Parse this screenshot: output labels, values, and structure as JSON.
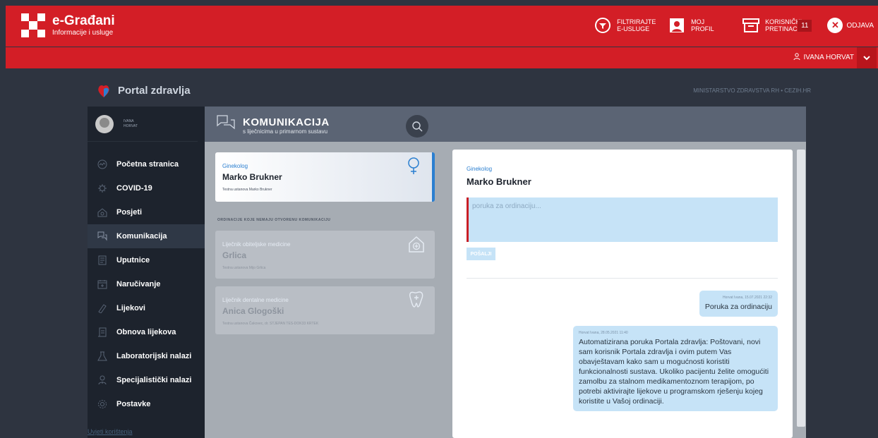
{
  "header": {
    "brand_title": "e-Građani",
    "brand_subtitle": "Informacije i usluge",
    "actions": [
      {
        "label": "FILTRIRAJTE E-USLUGE",
        "icon": "filter-icon"
      },
      {
        "label": "MOJ PROFIL",
        "icon": "profile-icon"
      },
      {
        "label": "KORISNIČKI PRETINAC",
        "icon": "inbox-icon",
        "badge": "11"
      }
    ],
    "logout_label": "ODJAVA"
  },
  "userbar": {
    "user_name": "IVANA HORVAT"
  },
  "portal": {
    "title": "Portal zdravlja",
    "ministry": "MINISTARSTVO ZDRAVSTVA RH • CEZIH.HR"
  },
  "sidebar": {
    "profile_first": "IVANA",
    "profile_last": "HORVAT",
    "items": [
      {
        "label": "Početna stranica",
        "icon": "home-icon"
      },
      {
        "label": "COVID-19",
        "icon": "virus-icon"
      },
      {
        "label": "Posjeti",
        "icon": "house-icon"
      },
      {
        "label": "Komunikacija",
        "icon": "chat-icon"
      },
      {
        "label": "Uputnice",
        "icon": "document-icon"
      },
      {
        "label": "Naručivanje",
        "icon": "calendar-icon"
      },
      {
        "label": "Lijekovi",
        "icon": "pill-icon"
      },
      {
        "label": "Obnova lijekova",
        "icon": "prescription-icon"
      },
      {
        "label": "Laboratorijski nalazi",
        "icon": "flask-icon"
      },
      {
        "label": "Specijalistički nalazi",
        "icon": "doctor-icon"
      },
      {
        "label": "Postavke",
        "icon": "gear-icon"
      }
    ],
    "terms": "Uvjeti korištenja"
  },
  "content": {
    "title": "KOMUNIKACIJA",
    "subtitle": "s liječnicima u primarnom sustavu"
  },
  "list": {
    "active": {
      "specialty": "Ginekolog",
      "doctor": "Marko Brukner",
      "institution": "Testna ustanova Marko Brukner"
    },
    "section_label": "ORDINACIJE KOJE NEMAJU OTVORENU KOMUNIKACIJU",
    "others": [
      {
        "specialty": "Liječnik obiteljske medicine",
        "doctor": "Grlica",
        "institution": "Testna ustanova Mijo Grlica"
      },
      {
        "specialty": "Liječnik dentalne medicine",
        "doctor": "Anica Glogoški",
        "institution": "Testna ustanova Čakovec, dr. STJEPAN TES-DOK33 KRTEK"
      }
    ]
  },
  "chat": {
    "specialty": "Ginekolog",
    "doctor": "Marko Brukner",
    "placeholder": "poruka za ordinaciju...",
    "send_label": "POŠALJI",
    "messages": [
      {
        "meta": "Horvat Ivana, 15.07.2021 22:32",
        "text": "Poruka za ordinaciju"
      },
      {
        "meta": "Horvat Ivana, 28.05.2021 11:40",
        "text": "Automatizirana poruka Portala zdravlja: Poštovani, novi sam korisnik Portala zdravlja i ovim putem Vas obavještavam kako sam u mogućnosti koristiti funkcionalnosti sustava. Ukoliko pacijentu želite omogućiti zamolbu za stalnom medikamentoznom terapijom, po potrebi aktivirajte lijekove u programskom rješenju kojeg koristite u Vašoj ordinaciji."
      }
    ]
  },
  "colors": {
    "brand_red": "#d31e26",
    "accent_blue": "#2b7fd0",
    "bubble": "#c6e3f7"
  }
}
